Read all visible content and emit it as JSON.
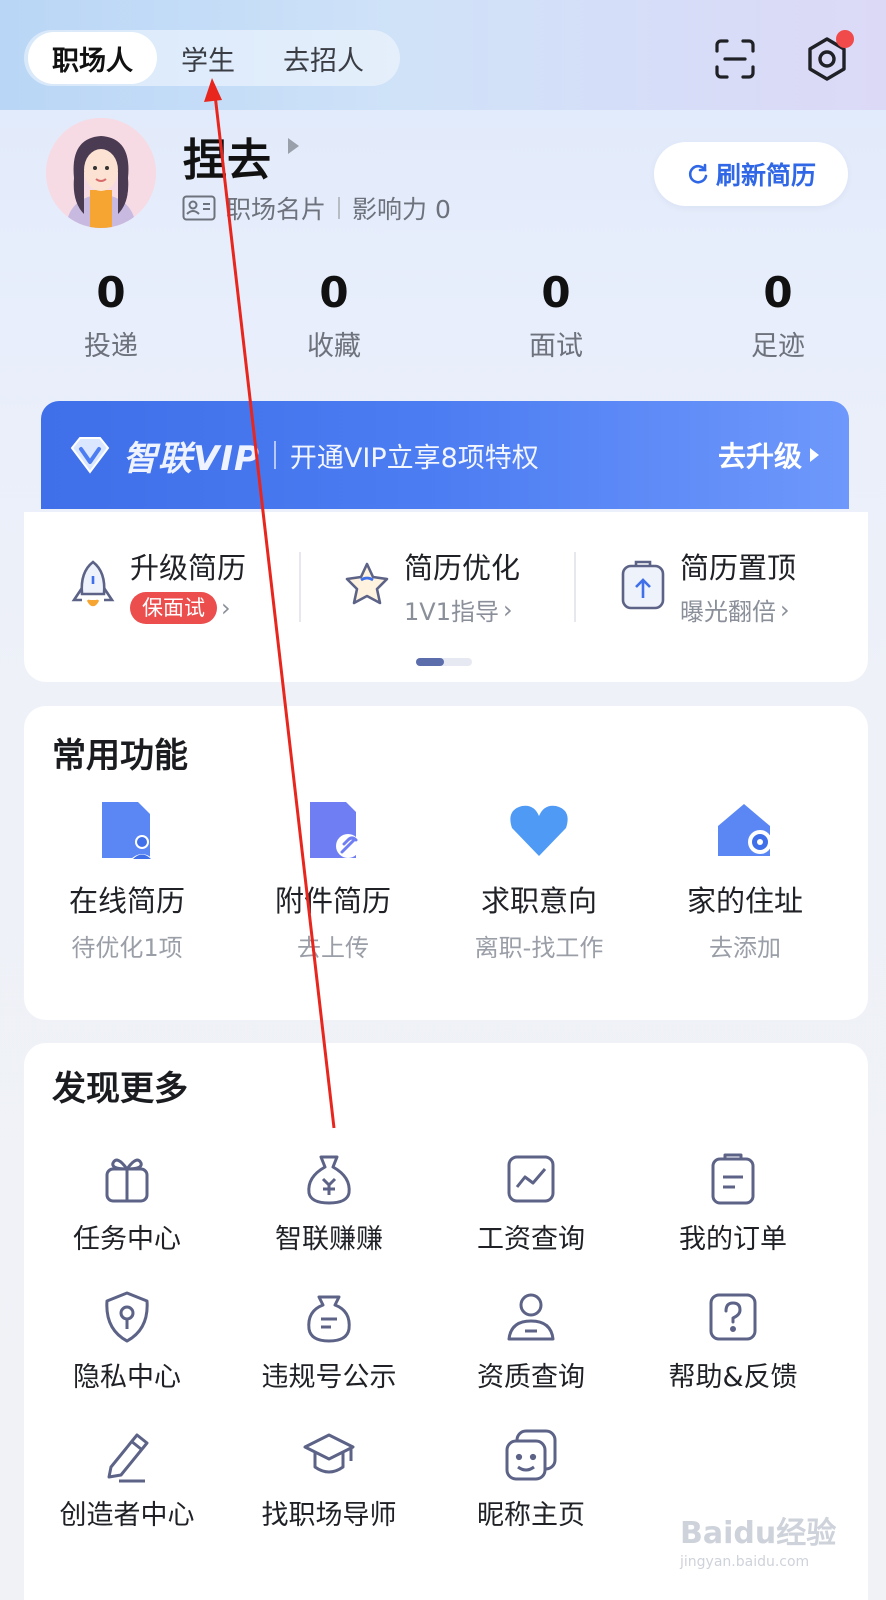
{
  "tabs": [
    "职场人",
    "学生",
    "去招人"
  ],
  "profile": {
    "name": "捏去",
    "card_label": "职场名片",
    "influence": "影响力 0",
    "refresh_label": "刷新简历"
  },
  "stats": [
    {
      "value": "0",
      "label": "投递"
    },
    {
      "value": "0",
      "label": "收藏"
    },
    {
      "value": "0",
      "label": "面试"
    },
    {
      "value": "0",
      "label": "足迹"
    }
  ],
  "vip": {
    "title": "智联VIP",
    "desc": "开通VIP立享8项特权",
    "action": "去升级"
  },
  "services": [
    {
      "title": "升级简历",
      "sub": "保面试"
    },
    {
      "title": "简历优化",
      "sub": "1V1指导"
    },
    {
      "title": "简历置顶",
      "sub": "曝光翻倍"
    }
  ],
  "common": {
    "title": "常用功能",
    "items": [
      {
        "title": "在线简历",
        "sub": "待优化1项"
      },
      {
        "title": "附件简历",
        "sub": "去上传"
      },
      {
        "title": "求职意向",
        "sub": "离职-找工作"
      },
      {
        "title": "家的住址",
        "sub": "去添加"
      }
    ]
  },
  "discover": {
    "title": "发现更多",
    "items": [
      "任务中心",
      "智联赚赚",
      "工资查询",
      "我的订单",
      "隐私中心",
      "违规号公示",
      "资质查询",
      "帮助&反馈",
      "创造者中心",
      "找职场导师",
      "昵称主页"
    ]
  },
  "watermark": {
    "main": "Baidu经验",
    "sub": "jingyan.baidu.com"
  },
  "colors": {
    "accent": "#2f67e6",
    "vip_bg": "#4d7df2",
    "icon": "#5c6387",
    "badge": "#ec4d4d",
    "annotation": "#e8261d"
  }
}
